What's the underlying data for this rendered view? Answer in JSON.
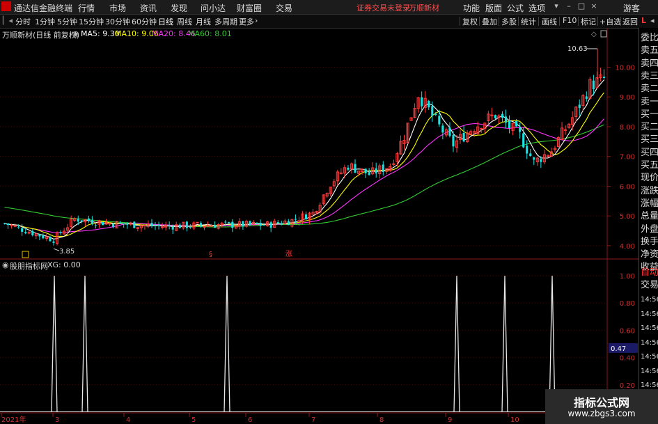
{
  "menubar": {
    "app_title": "通达信金融终端",
    "items": [
      "行情",
      "市场",
      "资讯",
      "发现",
      "问小达",
      "财富圈",
      "交易"
    ],
    "status_text": "证券交易未登录",
    "stock_name": "万顺新材",
    "right_items": [
      "功能",
      "版面",
      "公式",
      "选项"
    ],
    "user": "游客"
  },
  "tabbar": {
    "periods": [
      "分时",
      "1分钟",
      "5分钟",
      "15分钟",
      "30分钟",
      "60分钟",
      "日线",
      "周线",
      "月线",
      "多周期",
      "更多"
    ],
    "active_period": "日线",
    "tools": [
      "复权",
      "叠加",
      "多股",
      "统计",
      "画线",
      "F10",
      "标记",
      "+自选",
      "返回"
    ]
  },
  "main_chart": {
    "title": "万顺新材(日线 前复权)",
    "ma": [
      {
        "label": "MA5: 9.30",
        "color": "#ffffff"
      },
      {
        "label": "MA10: 9.06",
        "color": "#ffff00"
      },
      {
        "label": "MA20: 8.46",
        "color": "#ff33ff"
      },
      {
        "label": "MA60: 8.01",
        "color": "#33cc33"
      }
    ],
    "y_ticks": [
      "10.00",
      "9.00",
      "8.00",
      "7.00",
      "6.00",
      "5.00",
      "4.00"
    ],
    "high_label": "10.63",
    "low_label": "3.85",
    "markers": [
      "§",
      "涨"
    ]
  },
  "sub_chart": {
    "title": "股朋指标网",
    "value_label": "XG: 0.00",
    "y_ticks": [
      "1.00",
      "0.80",
      "0.60",
      "0.40",
      "0.20"
    ],
    "cursor_value": "0.47"
  },
  "x_axis": {
    "labels": [
      "2021年",
      "3",
      "4",
      "5",
      "6",
      "7",
      "8",
      "9",
      "10"
    ]
  },
  "right_panel": {
    "items": [
      "委比",
      "卖五",
      "卖四",
      "卖三",
      "卖二",
      "卖一",
      "买一",
      "买二",
      "买三",
      "买四",
      "买五",
      "现价",
      "涨跌",
      "涨幅",
      "总量",
      "外盘",
      "换手",
      "净资",
      "收益"
    ],
    "auto_trade": [
      "自动",
      "交易"
    ],
    "times": [
      "14:56",
      "14:56",
      "14:56",
      "14:56",
      "14:56",
      "14:56",
      "14:56",
      "14:56"
    ]
  },
  "watermark": {
    "line1": "指标公式网",
    "line2": "www.zbgs3.com"
  },
  "chart_data": {
    "type": "candlestick",
    "series": [
      {
        "name": "MA5",
        "values": []
      },
      {
        "name": "MA10",
        "values": []
      },
      {
        "name": "MA20",
        "values": []
      },
      {
        "name": "MA60",
        "values": []
      }
    ],
    "signal_peaks": {
      "name": "XG",
      "x_months": [
        "3",
        "3",
        "5",
        "8",
        "9",
        "9"
      ],
      "value": 1.0
    },
    "ylim": [
      3.6,
      10.9
    ]
  }
}
